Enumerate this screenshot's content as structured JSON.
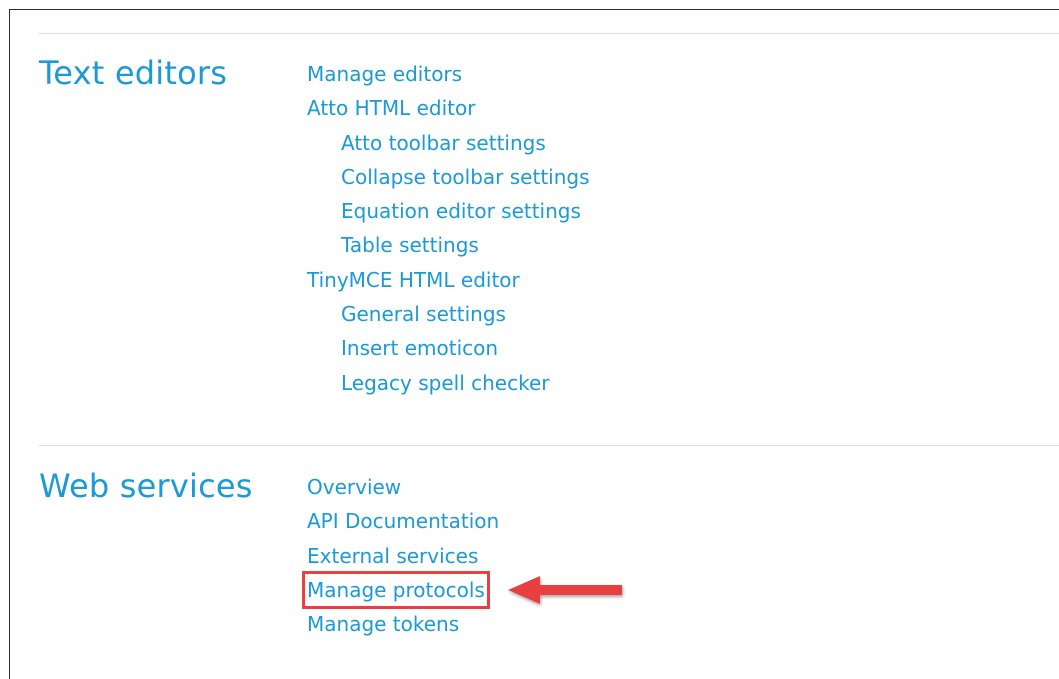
{
  "sections": [
    {
      "title": "Text editors",
      "links": [
        {
          "label": "Manage editors",
          "level": 0
        },
        {
          "label": "Atto HTML editor",
          "level": 0
        },
        {
          "label": "Atto toolbar settings",
          "level": 1
        },
        {
          "label": "Collapse toolbar settings",
          "level": 1
        },
        {
          "label": "Equation editor settings",
          "level": 1
        },
        {
          "label": "Table settings",
          "level": 1
        },
        {
          "label": "TinyMCE HTML editor",
          "level": 0
        },
        {
          "label": "General settings",
          "level": 1
        },
        {
          "label": "Insert emoticon",
          "level": 1
        },
        {
          "label": "Legacy spell checker",
          "level": 1
        }
      ]
    },
    {
      "title": "Web services",
      "links": [
        {
          "label": "Overview",
          "level": 0
        },
        {
          "label": "API Documentation",
          "level": 0
        },
        {
          "label": "External services",
          "level": 0
        },
        {
          "label": "Manage protocols",
          "level": 0,
          "highlighted": true
        },
        {
          "label": "Manage tokens",
          "level": 0
        }
      ]
    }
  ],
  "colors": {
    "link": "#1b9ad6",
    "highlight": "#e8413f",
    "divider": "#dcdcdc"
  },
  "annotation": {
    "icon": "arrow-left-icon"
  }
}
